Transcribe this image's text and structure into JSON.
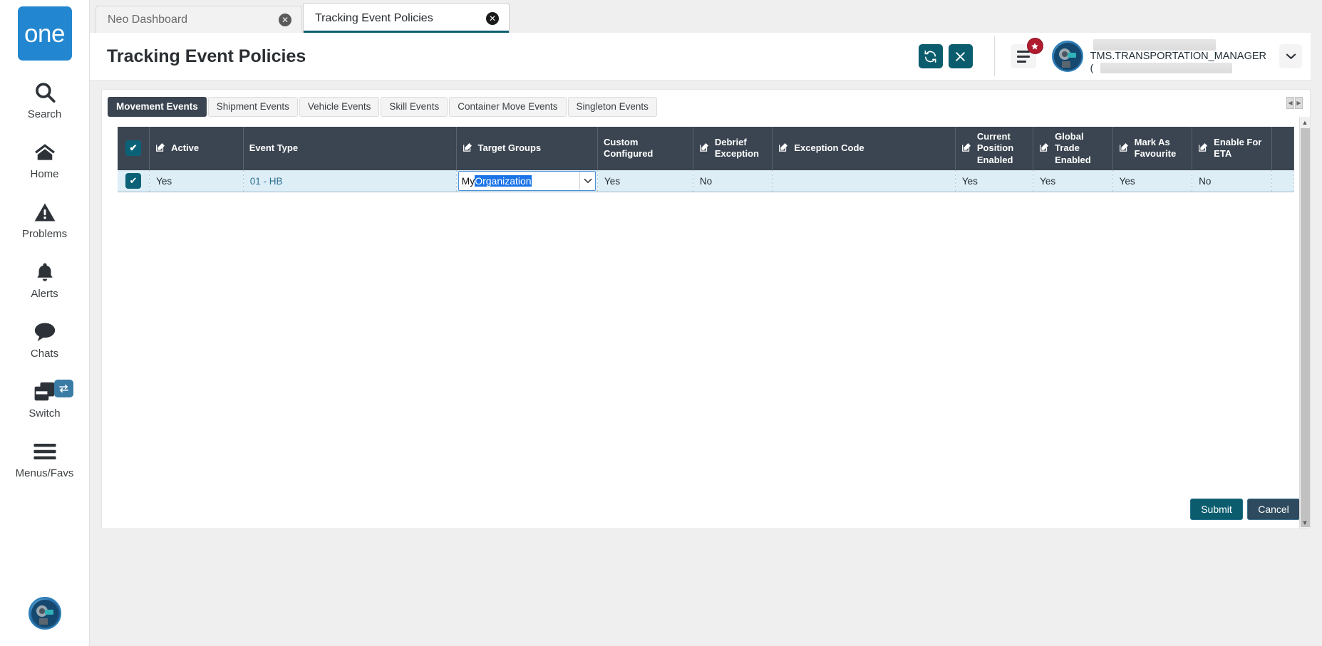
{
  "sidebar": {
    "logo_text": "one",
    "items": [
      {
        "label": "Search",
        "icon": "search-icon"
      },
      {
        "label": "Home",
        "icon": "home-icon"
      },
      {
        "label": "Problems",
        "icon": "warning-triangle-icon"
      },
      {
        "label": "Alerts",
        "icon": "bell-icon"
      },
      {
        "label": "Chats",
        "icon": "chat-bubble-icon"
      },
      {
        "label": "Switch",
        "icon": "windows-stack-icon",
        "badge_icon": "swap-arrows-icon"
      },
      {
        "label": "Menus/Favs",
        "icon": "hamburger-icon"
      }
    ]
  },
  "browser_tabs": [
    {
      "label": "Neo Dashboard",
      "active": false,
      "close": "✕"
    },
    {
      "label": "Tracking Event Policies",
      "active": true,
      "close": "✕"
    }
  ],
  "header": {
    "title": "Tracking Event Policies",
    "refresh_icon": "⟳",
    "close_icon": "✕",
    "badge_icon": "★",
    "user_name": "TMS.TRANSPORTATION_MANAGER",
    "user_org_prefix": "(",
    "caret_icon": "❯"
  },
  "panel": {
    "tabs": [
      {
        "label": "Movement Events",
        "active": true
      },
      {
        "label": "Shipment Events",
        "active": false
      },
      {
        "label": "Vehicle Events",
        "active": false
      },
      {
        "label": "Skill Events",
        "active": false
      },
      {
        "label": "Container Move Events",
        "active": false
      },
      {
        "label": "Singleton Events",
        "active": false
      }
    ],
    "hscroll_left": "◀",
    "hscroll_right": "▶",
    "select_all_check": "✔",
    "columns": [
      {
        "label": "Active",
        "editable": true
      },
      {
        "label": "Event Type",
        "editable": false
      },
      {
        "label": "Target Groups",
        "editable": true
      },
      {
        "label": "Custom Configured",
        "editable": false
      },
      {
        "label": "Debrief Exception",
        "editable": true
      },
      {
        "label": "Exception Code",
        "editable": true
      },
      {
        "label": "Current Position Enabled",
        "editable": true
      },
      {
        "label": "Global Trade Enabled",
        "editable": true
      },
      {
        "label": "Mark As Favourite",
        "editable": true
      },
      {
        "label": "Enable For ETA",
        "editable": true
      }
    ],
    "rows": [
      {
        "selected": true,
        "check": "✔",
        "active": "Yes",
        "event_type": "01 - HB",
        "target_groups": {
          "typed": "My ",
          "selected_suggestion": "Organization",
          "caret": "⌄"
        },
        "custom_configured": "Yes",
        "debrief_exception": "No",
        "exception_code": "",
        "current_position_enabled": "Yes",
        "global_trade_enabled": "Yes",
        "mark_as_favourite": "Yes",
        "enable_for_eta": "No"
      }
    ],
    "submit_label": "Submit",
    "cancel_label": "Cancel",
    "scroll_up": "▲",
    "scroll_down": "▼"
  },
  "colors": {
    "brand_blue": "#2286d0",
    "teal": "#0b5d6e",
    "header_dark": "#3b4551",
    "row_selected": "#ddeef7",
    "badge_red": "#b01b2e",
    "cancel_blue": "#2e4a5e"
  }
}
